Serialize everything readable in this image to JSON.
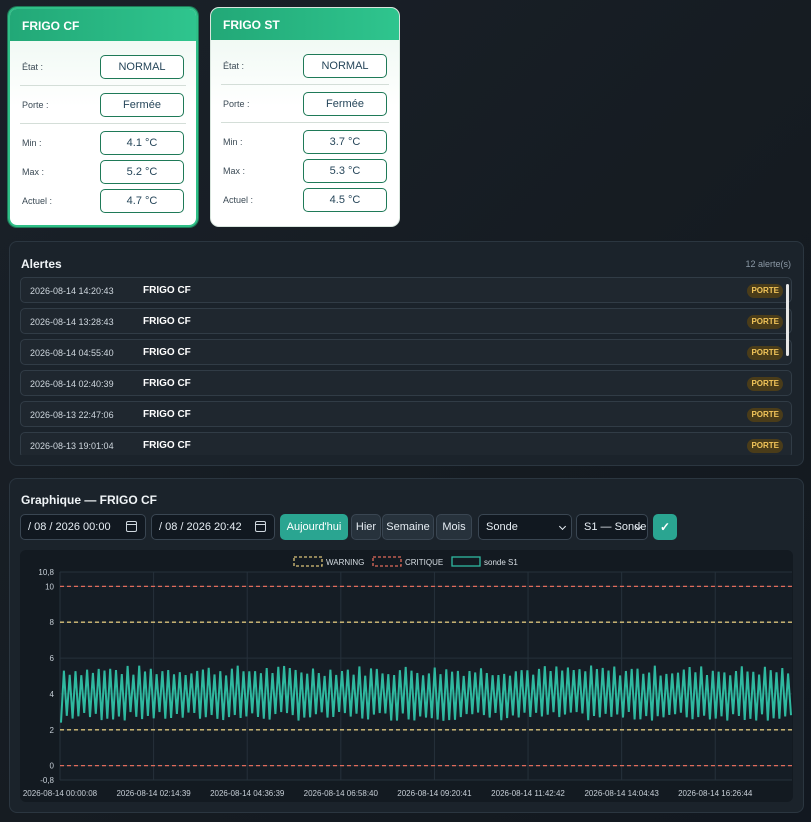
{
  "cards": [
    {
      "title": "FRIGO CF",
      "selected": true,
      "rows": [
        {
          "label": "État :",
          "value": "NORMAL"
        },
        {
          "label": "Porte :",
          "value": "Fermée"
        },
        {
          "label": "Min :",
          "value": "4.1 °C"
        },
        {
          "label": "Max :",
          "value": "5.2 °C"
        },
        {
          "label": "Actuel :",
          "value": "4.7 °C"
        }
      ]
    },
    {
      "title": "FRIGO ST",
      "selected": false,
      "rows": [
        {
          "label": "État :",
          "value": "NORMAL"
        },
        {
          "label": "Porte :",
          "value": "Fermée"
        },
        {
          "label": "Min :",
          "value": "3.7 °C"
        },
        {
          "label": "Max :",
          "value": "5.3 °C"
        },
        {
          "label": "Actuel :",
          "value": "4.5 °C"
        }
      ]
    }
  ],
  "alerts": {
    "title": "Alertes",
    "count": "12 alerte(s)",
    "items": [
      {
        "time": "2026-08-14 14:20:43",
        "device": "FRIGO CF",
        "type": "PORTE"
      },
      {
        "time": "2026-08-14 13:28:43",
        "device": "FRIGO CF",
        "type": "PORTE"
      },
      {
        "time": "2026-08-14 04:55:40",
        "device": "FRIGO CF",
        "type": "PORTE"
      },
      {
        "time": "2026-08-14 02:40:39",
        "device": "FRIGO CF",
        "type": "PORTE"
      },
      {
        "time": "2026-08-13 22:47:06",
        "device": "FRIGO CF",
        "type": "PORTE"
      },
      {
        "time": "2026-08-13 19:01:04",
        "device": "FRIGO CF",
        "type": "PORTE"
      }
    ]
  },
  "graph": {
    "title": "Graphique — FRIGO CF",
    "date_from": "/ 08 / 2026  00:00",
    "date_to": "/ 08 / 2026  20:42",
    "buttons": {
      "today": "Aujourd'hui",
      "yesterday": "Hier",
      "week": "Semaine",
      "month": "Mois"
    },
    "source_select": "Sonde",
    "probe_select": "S1 — Sonde",
    "apply": "✓"
  },
  "chart_data": {
    "type": "line",
    "legend_position": "top-center",
    "legend": [
      {
        "name": "WARNING",
        "color": "#d9c27a",
        "style": "dashed"
      },
      {
        "name": "CRITIQUE",
        "color": "#e06b5b",
        "style": "dashed"
      },
      {
        "name": "sonde S1",
        "color": "#2fb9a0",
        "style": "solid"
      }
    ],
    "ylim": [
      -0.8,
      10.8
    ],
    "y_ticks": [
      "10,8",
      "10",
      "8",
      "6",
      "4",
      "2",
      "0",
      "-0,8"
    ],
    "x_ticks": [
      "2026-08-14 00:00:08",
      "2026-08-14 02:14:39",
      "2026-08-14 04:36:39",
      "2026-08-14 06:58:40",
      "2026-08-14 09:20:41",
      "2026-08-14 11:42:42",
      "2026-08-14 14:04:43",
      "2026-08-14 16:26:44"
    ],
    "reference_lines": [
      {
        "name": "CRITIQUE",
        "y": 10,
        "color": "#e06b5b"
      },
      {
        "name": "WARNING",
        "y": 8,
        "color": "#d9c27a"
      },
      {
        "name": "WARNING",
        "y": 2,
        "color": "#d9c27a"
      },
      {
        "name": "CRITIQUE",
        "y": 0,
        "color": "#e06b5b"
      }
    ],
    "series": [
      {
        "name": "sonde S1",
        "color": "#2fb9a0",
        "oscillation": {
          "cycles": 126,
          "min_range": [
            2.5,
            3.0
          ],
          "max_range": [
            5.0,
            5.6
          ]
        }
      }
    ],
    "grid": true
  }
}
